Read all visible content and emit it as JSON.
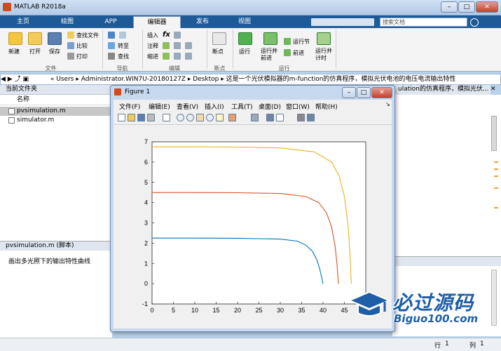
{
  "app": {
    "title": "MATLAB R2018a"
  },
  "tabs": [
    {
      "label": "主页"
    },
    {
      "label": "绘图"
    },
    {
      "label": "APP"
    },
    {
      "label": "编辑器"
    },
    {
      "label": "发布"
    },
    {
      "label": "视图"
    }
  ],
  "search": {
    "placeholder": "搜索文档"
  },
  "ribbon": {
    "file": {
      "new": "新建",
      "open": "打开",
      "save": "保存",
      "find_files": "查找文件",
      "compare": "比较",
      "print": "打印",
      "group": "文件"
    },
    "nav": {
      "goto": "转至",
      "find": "查找",
      "group": "导航"
    },
    "edit": {
      "insert": "插入",
      "comment": "注释",
      "indent": "缩进",
      "fx": "fx",
      "group": "编辑"
    },
    "breakpoints": {
      "label": "断点",
      "group": "断点"
    },
    "run": {
      "run": "运行",
      "run_advance": "运行并\n前进",
      "run_section": "运行节",
      "advance": "前进",
      "run_time": "运行并\n计时",
      "group": "运行"
    }
  },
  "address": {
    "segments": [
      "«",
      "Users",
      "▸",
      "Administrator.WIN7U-20180127Z",
      "▸",
      "Desktop",
      "▸",
      "这是一个光伏模拟器的m-function的仿真程序，模拟光伏电池的电压电流输出特性"
    ]
  },
  "left": {
    "current_folder": "当前文件夹",
    "col_name": "名称",
    "files": [
      {
        "name": "pvsimulation.m"
      },
      {
        "name": "simulator.m"
      }
    ],
    "detail_title": "pvsimulation.m  (脚本)",
    "detail_text": "画出多光照下的输出特性曲线"
  },
  "editor": {
    "header": "ulation的仿真程序，模拟光伏..."
  },
  "status": {
    "row_label": "行",
    "row": "1",
    "col_label": "列",
    "col": "1"
  },
  "figure": {
    "title": "Figure 1",
    "menus": [
      "文件(F)",
      "编辑(E)",
      "查看(V)",
      "插入(I)",
      "工具(T)",
      "桌面(D)",
      "窗口(W)",
      "帮助(H)"
    ]
  },
  "chart_data": {
    "type": "line",
    "xlim": [
      0,
      50
    ],
    "ylim": [
      -1,
      7
    ],
    "xticks": [
      0,
      5,
      10,
      15,
      20,
      25,
      30,
      35,
      40,
      45
    ],
    "yticks": [
      -1,
      0,
      1,
      2,
      3,
      4,
      5,
      6,
      7
    ],
    "series": [
      {
        "color": "#0072bd",
        "x": [
          0,
          10,
          20,
          30,
          34,
          36,
          37.5,
          38.5,
          39.2,
          39.7,
          40.0
        ],
        "y": [
          2.25,
          2.25,
          2.24,
          2.2,
          2.1,
          1.9,
          1.6,
          1.2,
          0.75,
          0.3,
          0.0
        ]
      },
      {
        "color": "#d95319",
        "x": [
          0,
          10,
          20,
          30,
          36,
          39,
          40.8,
          42,
          42.8,
          43.3,
          43.6
        ],
        "y": [
          4.5,
          4.5,
          4.49,
          4.45,
          4.3,
          4.0,
          3.5,
          2.8,
          1.9,
          0.9,
          0.0
        ]
      },
      {
        "color": "#edb120",
        "x": [
          0,
          10,
          20,
          30,
          38,
          42,
          43.8,
          45,
          45.8,
          46.3,
          46.6
        ],
        "y": [
          6.75,
          6.75,
          6.74,
          6.7,
          6.5,
          6.0,
          5.3,
          4.3,
          3.0,
          1.5,
          0.0
        ]
      }
    ]
  },
  "watermark": {
    "cn": "必过源码",
    "en": "Biguo100.com"
  },
  "colors": {
    "tabbar": "#1e5b96",
    "accent": "#0072bd"
  }
}
